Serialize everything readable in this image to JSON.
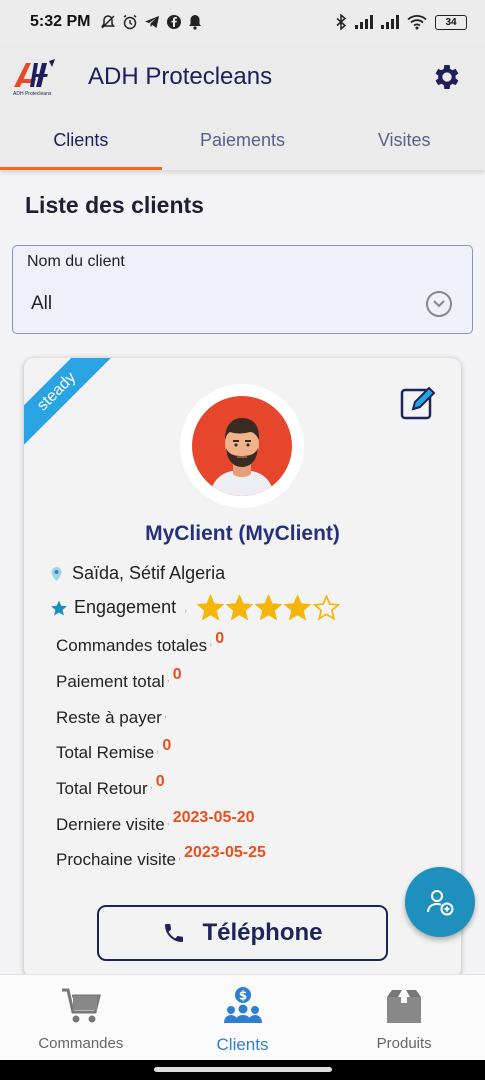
{
  "status_bar": {
    "time": "5:32 PM",
    "battery": "34"
  },
  "app_bar": {
    "title": "ADH Protecleans",
    "logo_text": "ADH Protecleans"
  },
  "tabs": [
    {
      "label": "Clients",
      "active": true
    },
    {
      "label": "Paiements",
      "active": false
    },
    {
      "label": "Visites",
      "active": false
    }
  ],
  "section_title": "Liste des clients",
  "filter": {
    "label": "Nom du client",
    "value": "All"
  },
  "client_card": {
    "ribbon": "steady",
    "name": "MyClient (MyClient)",
    "location": "Saïda, Sétif Algeria",
    "engagement_label": "Engagement",
    "engagement_rating": 4,
    "engagement_max": 5,
    "stats": [
      {
        "label": "Commandes totales",
        "value": "0"
      },
      {
        "label": "Paiement total",
        "value": "0"
      },
      {
        "label": "Reste à payer",
        "value": ""
      },
      {
        "label": "Total Remise",
        "value": "0"
      },
      {
        "label": "Total Retour",
        "value": "0"
      },
      {
        "label": "Derniere visite",
        "value": "2023-05-20"
      },
      {
        "label": "Prochaine visite",
        "value": "2023-05-25"
      }
    ],
    "phone_button": "Téléphone"
  },
  "bottom_nav": [
    {
      "label": "Commandes",
      "icon": "cart-icon",
      "active": false
    },
    {
      "label": "Clients",
      "icon": "clients-icon",
      "active": true
    },
    {
      "label": "Produits",
      "icon": "products-box-icon",
      "active": false
    }
  ],
  "colors": {
    "brand_navy": "#1d1f5a",
    "accent_orange": "#f26a1b",
    "ribbon_blue": "#2aa3e3",
    "fab_blue": "#1f8fbd",
    "star_gold": "#f5b50a",
    "value_red": "#ea4f1e",
    "nav_active": "#2f7fd0"
  }
}
